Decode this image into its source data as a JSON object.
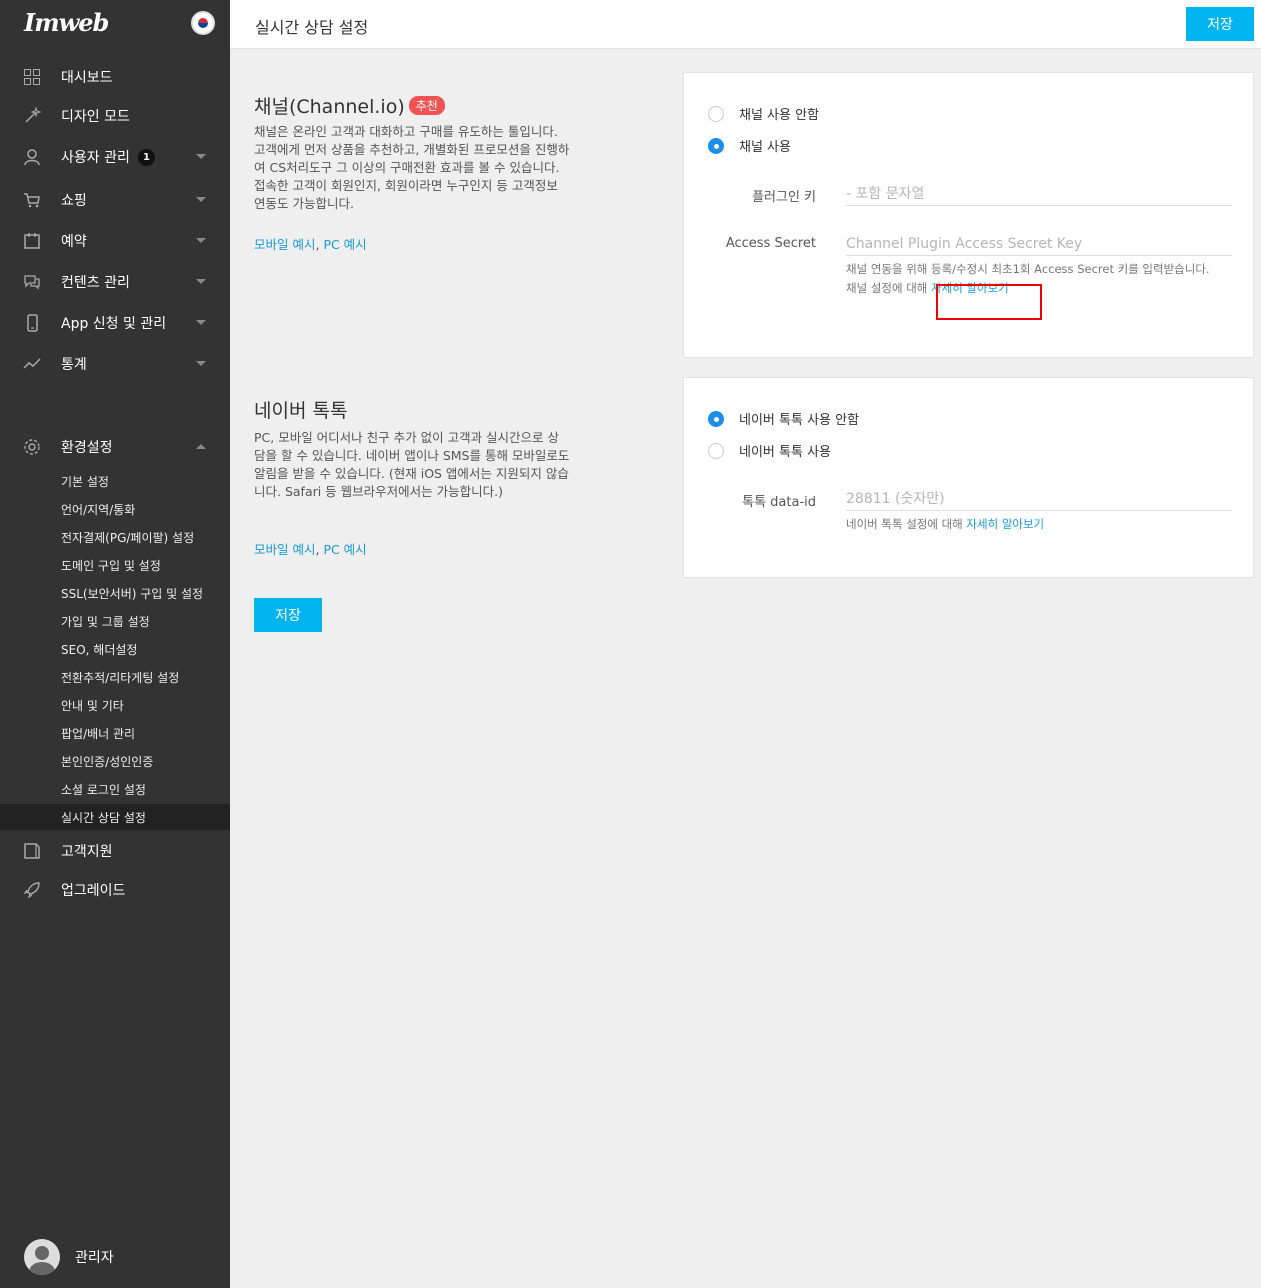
{
  "app": {
    "logo": "Imweb"
  },
  "sidebar": {
    "items": [
      {
        "label": "대시보드"
      },
      {
        "label": "디자인 모드"
      },
      {
        "label": "사용자 관리",
        "badge": "1"
      },
      {
        "label": "쇼핑"
      },
      {
        "label": "예약"
      },
      {
        "label": "컨텐츠 관리"
      },
      {
        "label": "App 신청 및 관리"
      },
      {
        "label": "통계"
      }
    ],
    "settings": {
      "label": "환경설정"
    },
    "sub_items": [
      "기본 설정",
      "언어/지역/통화",
      "전자결제(PG/페이팔) 설정",
      "도메인 구입 및 설정",
      "SSL(보안서버) 구입 및 설정",
      "가입 및 그룹 설정",
      "SEO, 해더설정",
      "전환추적/리타게팅 설정",
      "안내 및 기타",
      "팝업/배너 관리",
      "본인인증/성인인증",
      "소셜 로그인 설정",
      "실시간 상담 설정"
    ],
    "bottom_items": [
      {
        "label": "고객지원"
      },
      {
        "label": "업그레이드"
      }
    ],
    "user": {
      "name": "관리자"
    }
  },
  "header": {
    "title": "실시간 상담 설정",
    "save_label": "저장"
  },
  "channel": {
    "title": "채널(Channel.io)",
    "badge": "추천",
    "description": "채널은 온라인 고객과 대화하고 구매를 유도하는 툴입니다. 고객에게 먼저 상품을 추천하고, 개별화된 프로모션을 진행하여 CS처리도구 그 이상의 구매전환 효과를 볼 수 있습니다. 접속한 고객이 회원인지, 회원이라면 누구인지 등 고객정보 연동도 가능합니다.",
    "link_mobile": "모바일 예시",
    "link_sep": ", ",
    "link_pc": "PC 예시",
    "radio_off": "채널 사용 안함",
    "radio_on": "채널 사용",
    "selected": "on",
    "plugin_key_label": "플러그인 키",
    "plugin_key_placeholder": "- 포함 문자열",
    "secret_label": "Access Secret",
    "secret_placeholder": "Channel Plugin Access Secret Key",
    "help_line1": "채널 연동을 위해 등록/수정시 최초1회 Access Secret 키를 입력받습니다.",
    "help_prefix": "채널 설정에 대해 ",
    "help_link": "자세히 알아보기"
  },
  "naver": {
    "title": "네이버 톡톡",
    "description": "PC, 모바일 어디서나 친구 추가 없이 고객과 실시간으로 상담을 할 수 있습니다. 네이버 앱이나 SMS를 통해 모바일로도 알림을 받을 수 있습니다. (현재 iOS 앱에서는 지원되지 않습니다. Safari 등 웹브라우저에서는 가능합니다.)",
    "link_mobile": "모바일 예시",
    "link_sep": ", ",
    "link_pc": "PC 예시",
    "radio_off": "네이버 톡톡 사용 안함",
    "radio_on": "네이버 톡톡 사용",
    "selected": "off",
    "id_label": "톡톡 data-id",
    "id_placeholder": "28811 (숫자만)",
    "help_prefix": "네이버 톡톡 설정에 대해 ",
    "help_link": "자세히 알아보기"
  },
  "footer": {
    "save_label": "저장"
  },
  "colors": {
    "accent": "#00b4f0",
    "sidebar_bg": "#333333",
    "badge_red": "#ef5353",
    "highlight": "#ee0000"
  }
}
